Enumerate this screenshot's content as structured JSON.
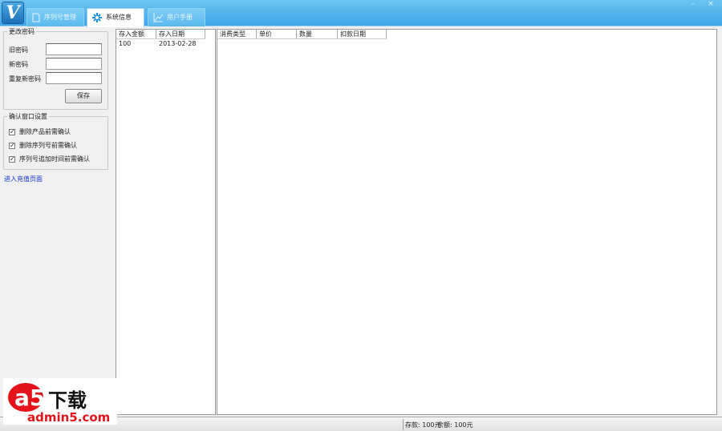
{
  "tabs": [
    {
      "label": "序列号管理",
      "icon": "document-icon"
    },
    {
      "label": "系统信息",
      "icon": "gear-icon"
    },
    {
      "label": "用户手册",
      "icon": "chart-icon"
    }
  ],
  "logo": "V",
  "window_buttons": {
    "minimize": "–",
    "close": "×"
  },
  "password_group": {
    "title": "更改密码",
    "old_label": "旧密码",
    "new_label": "新密码",
    "repeat_label": "重复新密码",
    "old_value": "",
    "new_value": "",
    "repeat_value": "",
    "save_label": "保存"
  },
  "confirm_group": {
    "title": "确认窗口设置",
    "items": [
      {
        "label": "删除产品前需确认",
        "checked": true
      },
      {
        "label": "删除序列号前需确认",
        "checked": true
      },
      {
        "label": "序列号追加时间前需确认",
        "checked": true
      }
    ]
  },
  "recharge_link": "进入充值页面",
  "deposit_list": {
    "columns": [
      "存入金额",
      "存入日期"
    ],
    "rows": [
      [
        "100",
        "2013-02-28"
      ]
    ]
  },
  "consume_list": {
    "columns": [
      "消费类型",
      "单价",
      "数量",
      "扣款日期"
    ],
    "rows": []
  },
  "status": {
    "deposit": "存款: 100元",
    "balance": "余额: 100元"
  },
  "watermark": {
    "brand": "a5下载",
    "site": "admin5.com"
  }
}
